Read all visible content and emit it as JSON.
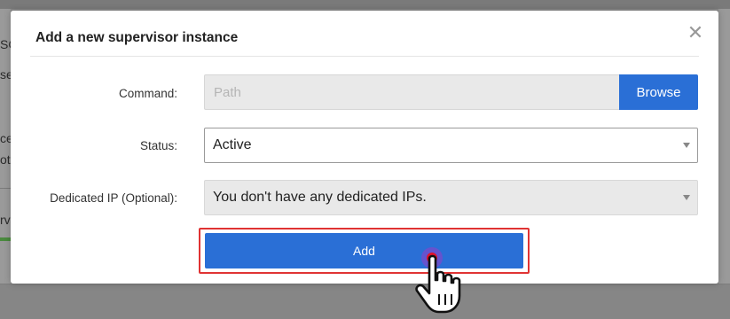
{
  "background": {
    "fragments": [
      "SC",
      "se",
      "ce",
      "ot",
      "rv"
    ]
  },
  "modal": {
    "title": "Add a new supervisor instance",
    "close_icon": "close-icon"
  },
  "form": {
    "command": {
      "label": "Command:",
      "value": "",
      "placeholder": "Path",
      "browse_label": "Browse"
    },
    "status": {
      "label": "Status:",
      "selected": "Active"
    },
    "dedicated_ip": {
      "label": "Dedicated IP (Optional):",
      "selected": "You don't have any dedicated IPs."
    },
    "add_label": "Add"
  },
  "colors": {
    "primary_button": "#2a6fd6",
    "highlight_outline": "#e03333",
    "click_marker": "#e0102a"
  },
  "cursor_icon": "hand-pointer-icon"
}
